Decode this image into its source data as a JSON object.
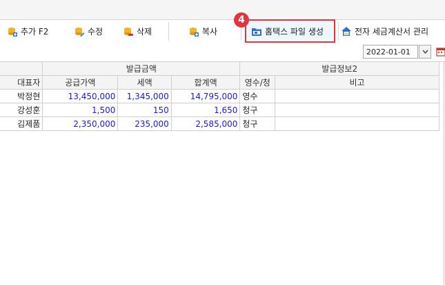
{
  "toolbar": {
    "add_label": "추가 F2",
    "edit_label": "수정",
    "delete_label": "삭제",
    "copy_label": "복사",
    "hometax_label": "홈택스 파일 생성",
    "etax_label": "전자 세금계산서 관리"
  },
  "callout": {
    "number": "4"
  },
  "filter": {
    "date": "2022-01-01"
  },
  "table": {
    "group_headers": {
      "amount": "발급금액",
      "info": "발급정보2"
    },
    "columns": {
      "rep": "대표자",
      "supply": "공급가액",
      "tax": "세액",
      "total": "합계액",
      "receipt": "영수/청",
      "note": "비고"
    },
    "rows": [
      {
        "rep": "박정현",
        "supply": "13,450,000",
        "tax": "1,345,000",
        "total": "14,795,000",
        "receipt": "영수",
        "note": ""
      },
      {
        "rep": "강성훈",
        "supply": "1,500",
        "tax": "150",
        "total": "1,650",
        "receipt": "청구",
        "note": ""
      },
      {
        "rep": "김제품",
        "supply": "2,350,000",
        "tax": "235,000",
        "total": "2,585,000",
        "receipt": "청구",
        "note": ""
      }
    ]
  },
  "colors": {
    "highlight": "#e0343f",
    "number_text": "#1a1adb"
  }
}
